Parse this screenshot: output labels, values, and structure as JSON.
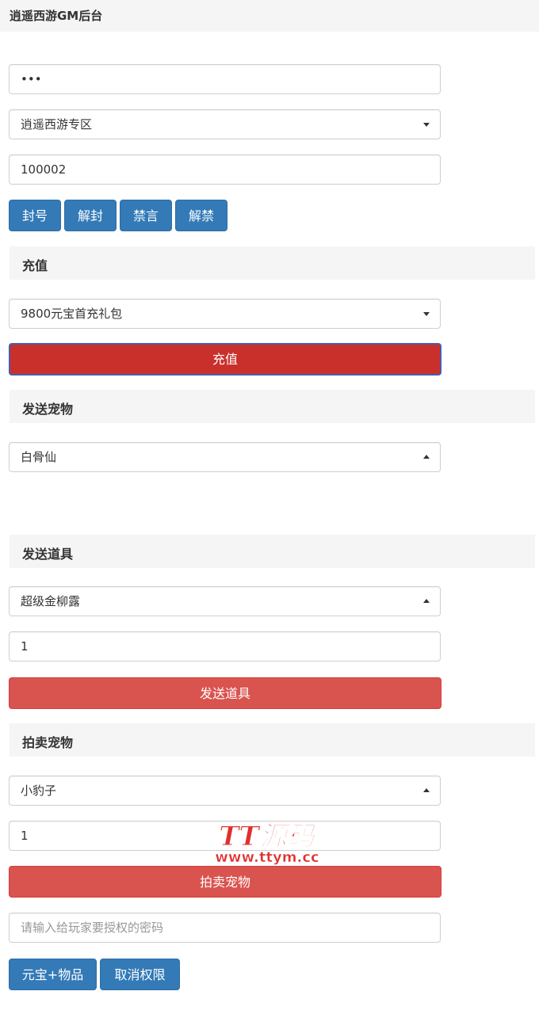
{
  "app": {
    "title": "逍遥西游GM后台"
  },
  "account": {
    "password_value": "•••",
    "server_selected": "逍遥西游专区",
    "role_id_value": "100002",
    "actions": [
      "封号",
      "解封",
      "禁言",
      "解禁"
    ]
  },
  "recharge": {
    "section_title": "充值",
    "package_selected": "9800元宝首充礼包",
    "submit_label": "充值"
  },
  "send_pet": {
    "section_title": "发送宠物",
    "pet_selected": "白骨仙"
  },
  "send_item": {
    "section_title": "发送道具",
    "item_selected": "超级金柳露",
    "quantity_value": "1",
    "submit_label": "发送道具"
  },
  "auction_pet": {
    "section_title": "拍卖宠物",
    "pet_selected": "小豹子",
    "quantity_value": "1",
    "submit_label": "拍卖宠物"
  },
  "authorization": {
    "password_placeholder": "请输入给玩家要授权的密码",
    "grant_label": "元宝+物品",
    "revoke_label": "取消权限"
  },
  "watermark": {
    "brand": "TT源码",
    "url": "www.ttym.cc"
  },
  "colors": {
    "primary": "#337ab7",
    "danger": "#d9534f",
    "danger_active": "#c9302c",
    "section_bg": "#f5f5f5"
  }
}
